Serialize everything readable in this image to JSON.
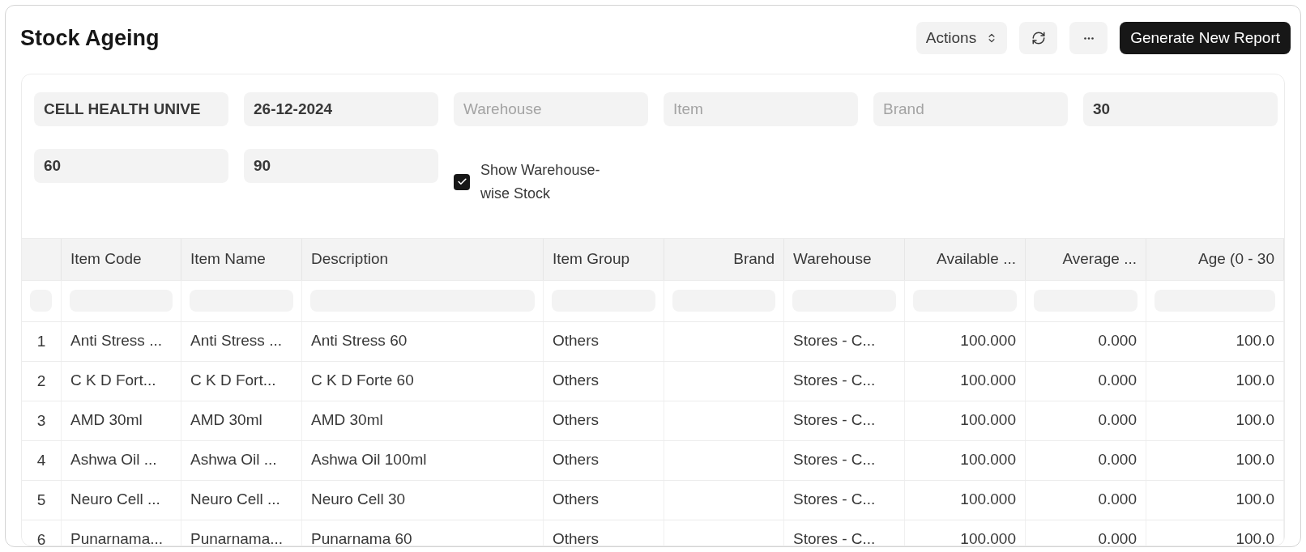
{
  "page": {
    "title": "Stock Ageing"
  },
  "toolbar": {
    "actions": {
      "label": "Actions"
    },
    "primary": {
      "label": "Generate New Report"
    }
  },
  "filters": [
    {
      "value": "CELL HEALTH UNIVE"
    },
    {
      "value": "26-12-2024"
    },
    {
      "placeholder": "Warehouse"
    },
    {
      "placeholder": "Item"
    },
    {
      "placeholder": "Brand"
    },
    {
      "value": "30"
    },
    {
      "value": "60"
    },
    {
      "value": "90"
    }
  ],
  "show_warehouse_stock": {
    "label": "Show Warehouse-wise Stock",
    "checked": true
  },
  "table": {
    "columns": [
      {
        "label": "Item Code",
        "kind": "text"
      },
      {
        "label": "Item Name",
        "kind": "text"
      },
      {
        "label": "Description",
        "kind": "text"
      },
      {
        "label": "Item Group",
        "kind": "text"
      },
      {
        "label": "Brand",
        "kind": "number"
      },
      {
        "label": "Warehouse",
        "kind": "text"
      },
      {
        "label": "Available ...",
        "kind": "number"
      },
      {
        "label": "Average ...",
        "kind": "number"
      },
      {
        "label": "Age (0 - 30",
        "kind": "number"
      }
    ],
    "rows": [
      {
        "index": "1",
        "cells": [
          "Anti Stress ...",
          "Anti Stress ...",
          "Anti Stress 60",
          "Others",
          null,
          "Stores - C...",
          "100.000",
          "0.000",
          "100.0"
        ]
      },
      {
        "index": "2",
        "cells": [
          "C K D Fort...",
          "C K D Fort...",
          "C K D Forte 60",
          "Others",
          null,
          "Stores - C...",
          "100.000",
          "0.000",
          "100.0"
        ]
      },
      {
        "index": "3",
        "cells": [
          "AMD 30ml",
          "AMD 30ml",
          "AMD 30ml",
          "Others",
          null,
          "Stores - C...",
          "100.000",
          "0.000",
          "100.0"
        ]
      },
      {
        "index": "4",
        "cells": [
          "Ashwa Oil ...",
          "Ashwa Oil ...",
          "Ashwa Oil 100ml",
          "Others",
          null,
          "Stores - C...",
          "100.000",
          "0.000",
          "100.0"
        ]
      },
      {
        "index": "5",
        "cells": [
          "Neuro Cell ...",
          "Neuro Cell ...",
          "Neuro Cell 30",
          "Others",
          null,
          "Stores - C...",
          "100.000",
          "0.000",
          "100.0"
        ]
      },
      {
        "index": "6",
        "cells": [
          "Punarnama...",
          "Punarnama...",
          "Punarnama 60",
          "Others",
          null,
          "Stores - C...",
          "100.000",
          "0.000",
          "100.0"
        ]
      }
    ]
  }
}
